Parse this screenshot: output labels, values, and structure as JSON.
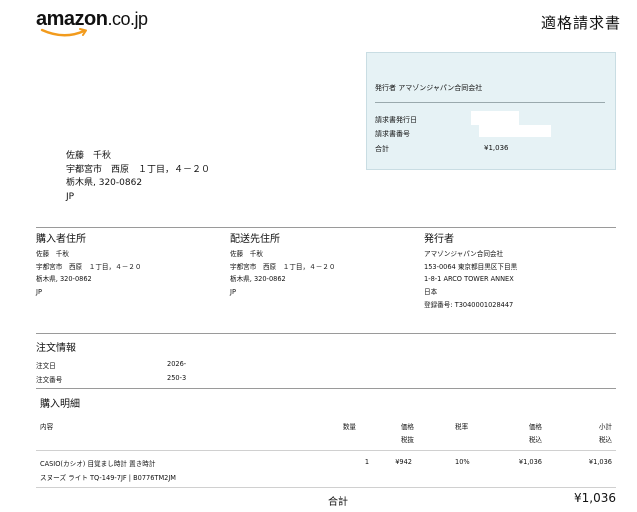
{
  "logo": {
    "main": "amazon",
    "tld": ".co.jp"
  },
  "doc_title": "適格請求書",
  "info_box": {
    "issuer_line": "発行者 アマゾンジャパン合同会社",
    "rows": [
      {
        "label": "請求書発行日",
        "value": ""
      },
      {
        "label": "請求書番号",
        "value": ""
      },
      {
        "label": "合計",
        "value": "¥1,036"
      }
    ]
  },
  "recipient": {
    "name": "佐藤　千秋",
    "line1": "宇都宮市　西原　１丁目，４－２０",
    "line2": "栃木県, 320-0862",
    "country": "JP"
  },
  "buyer": {
    "heading": "購入者住所",
    "lines": [
      "佐藤　千秋",
      "宇都宮市　西原　１丁目，４－２０",
      "栃木県, 320-0862",
      "JP"
    ]
  },
  "shipping": {
    "heading": "配送先住所",
    "lines": [
      "佐藤　千秋",
      "宇都宮市　西原　１丁目，４－２０",
      "栃木県, 320-0862",
      "JP"
    ]
  },
  "issuer": {
    "heading": "発行者",
    "lines": [
      "アマゾンジャパン合同会社",
      "153-0064 東京都目黒区下目黒",
      "1-8-1 ARCO TOWER ANNEX",
      "日本",
      "登録番号: T3040001028447"
    ]
  },
  "order_info": {
    "title": "注文情報",
    "date_label": "注文日",
    "date_value": "2026-",
    "number_label": "注文番号",
    "number_value": "250-3"
  },
  "purchase": {
    "title": "購入明細",
    "columns": {
      "content": "内容",
      "qty": "数量",
      "price_ex_1": "価格",
      "price_ex_2": "税抜",
      "tax_rate": "税率",
      "price_in_1": "価格",
      "price_in_2": "税込",
      "subtotal_1": "小計",
      "subtotal_2": "税込"
    },
    "items": [
      {
        "line1": "CASIO(カシオ) 目覚まし時計 置き時計",
        "line2": "スヌーズ ライト TQ-149-7JF | B0776TM2JM",
        "qty": "1",
        "price_ex": "¥942",
        "tax_rate": "10%",
        "price_in": "¥1,036",
        "subtotal": "¥1,036"
      }
    ],
    "total_label": "合計",
    "total_value": "¥1,036"
  }
}
